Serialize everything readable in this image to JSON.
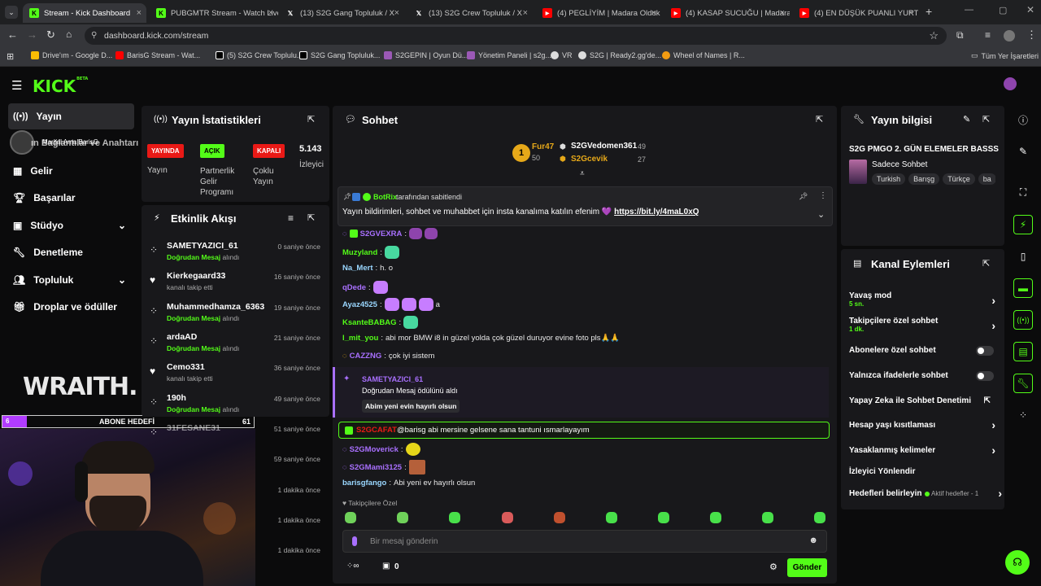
{
  "browser": {
    "tabs": [
      {
        "label": "Stream - Kick Dashboard",
        "icon": "kick-icon",
        "color": "#53fc18"
      },
      {
        "label": "PUBGMTR Stream - Watch Live",
        "icon": "kick-icon",
        "color": "#53fc18"
      },
      {
        "label": "(13) S2G Gang Topluluk / X",
        "icon": "x-icon",
        "color": "#ffffff"
      },
      {
        "label": "(13) S2G Crew Topluluk / X",
        "icon": "x-icon",
        "color": "#ffffff"
      },
      {
        "label": "(4) PEGLİYİM | Madara Olduk #",
        "icon": "youtube-icon",
        "color": "#ff0000"
      },
      {
        "label": "(4) KASAP SUCUĞU | Madara O",
        "icon": "youtube-icon",
        "color": "#ff0000"
      },
      {
        "label": "(4) EN DÜŞÜK PUANLI YURT D",
        "icon": "youtube-icon",
        "color": "#ff0000"
      }
    ],
    "new_tab": "+",
    "url": "dashboard.kick.com/stream",
    "bookmarks": [
      {
        "label": "Drive'ım - Google D...",
        "color": "#fbbc04"
      },
      {
        "label": "BarisG Stream - Wat...",
        "color": "#ff0000"
      },
      {
        "label": "(5) S2G Crew Toplulu...",
        "color": "#ffffff"
      },
      {
        "label": "S2G Gang Topluluk...",
        "color": "#ffffff"
      },
      {
        "label": "S2GEPIN | Oyun Dü...",
        "color": "#9b59b6"
      },
      {
        "label": "Yönetim Paneli | s2g...",
        "color": "#9b59b6"
      },
      {
        "label": "VR",
        "color": "#ffffff"
      },
      {
        "label": "S2G | Ready2.gg'de...",
        "color": "#ffffff"
      },
      {
        "label": "Wheel of Names | R...",
        "color": "#f39c12"
      }
    ],
    "all_bookmarks": "Tüm Yer İşaretleri"
  },
  "kick": {
    "logo": "KICK",
    "logo_beta": "BETA",
    "accent": "#53fc18"
  },
  "sidebar": {
    "items": [
      {
        "label": "Yayın",
        "icon": "broadcast-icon"
      },
      {
        "label": "Gelir",
        "icon": "chart-icon"
      },
      {
        "label": "Başarılar",
        "icon": "trophy-icon"
      },
      {
        "label": "Stüdyo",
        "icon": "studio-icon"
      },
      {
        "label": "Denetleme",
        "icon": "wrench-icon"
      },
      {
        "label": "Topluluk",
        "icon": "people-icon"
      },
      {
        "label": "Droplar ve ödüller",
        "icon": "gift-icon"
      }
    ],
    "overlay_text_1": "Marşal Ama BarisG",
    "overlay_text_2": "ın Bağlantılar ve Anahtarı"
  },
  "overlay": {
    "brand": "WRAITH.",
    "goal_label": "ABONE HEDEFİ",
    "goal_current": "6",
    "goal_target": "61",
    "goal_fraction": 0.098
  },
  "stats": {
    "title": "Yayın İstatistikleri",
    "items": [
      {
        "badge": "YAYINDA",
        "label": "Yayın",
        "color": "#e91916"
      },
      {
        "badge": "AÇIK",
        "label": "Partnerlik Gelir Programı",
        "color": "#53fc18"
      },
      {
        "badge": "KAPALI",
        "label": "Çoklu Yayın",
        "color": "#e91916"
      },
      {
        "badge": "5.143",
        "label": "İzleyici",
        "color": ""
      }
    ]
  },
  "activity": {
    "title": "Etkinlik Akışı",
    "rows": [
      {
        "name": "SAMETYAZICI_61",
        "pre": "",
        "hl": "Doğrudan Mesaj",
        "post": " alındı",
        "time": "0 saniye önce",
        "icon": "gift-icon"
      },
      {
        "name": "Kierkegaard33",
        "pre": "kanalı takip etti",
        "hl": "",
        "post": "",
        "time": "16 saniye önce",
        "icon": "heart-icon"
      },
      {
        "name": "Muhammedhamza_6363",
        "pre": "",
        "hl": "Doğrudan Mesaj",
        "post": " alındı",
        "time": "19 saniye önce",
        "icon": "gift-icon"
      },
      {
        "name": "ardaAD",
        "pre": "",
        "hl": "Doğrudan Mesaj",
        "post": " alındı",
        "time": "21 saniye önce",
        "icon": "gift-icon"
      },
      {
        "name": "Cemo331",
        "pre": "kanalı takip etti",
        "hl": "",
        "post": "",
        "time": "36 saniye önce",
        "icon": "heart-icon"
      },
      {
        "name": "190h",
        "pre": "",
        "hl": "Doğrudan Mesaj",
        "post": " alındı",
        "time": "49 saniye önce",
        "icon": "gift-icon"
      },
      {
        "name": "31FESANE31",
        "pre": "",
        "hl": "",
        "post": "",
        "time": "51 saniye önce",
        "icon": "gift-icon"
      },
      {
        "name": "",
        "pre": "",
        "hl": "",
        "post": "",
        "time": "59 saniye önce",
        "icon": ""
      },
      {
        "name": "",
        "pre": "",
        "hl": "",
        "post": "",
        "time": "1 dakika önce",
        "icon": ""
      },
      {
        "name": "",
        "pre": "",
        "hl": "",
        "post": "",
        "time": "1 dakika önce",
        "icon": ""
      },
      {
        "name": "",
        "pre": "",
        "hl": "",
        "post": "",
        "time": "1 dakika önce",
        "icon": ""
      }
    ]
  },
  "chat": {
    "title": "Sohbet",
    "leaders": {
      "rank": "1",
      "first_name": "Fur47",
      "first_value": "50",
      "second_name": "S2GVedomen361",
      "second_value": "49",
      "third_name": "S2Gcevik",
      "third_value": "27"
    },
    "pinned": {
      "by_user": "BotRix",
      "by_text": "tarafından sabitlendi",
      "text": "Yayın bildirimleri, sohbet ve muhabbet için insta kanalıma katılın efenim 💜",
      "link": "https://bit.ly/4maL0xQ"
    },
    "messages": [
      {
        "user": "S2GVEXRA",
        "text": "",
        "color": "#a970ff"
      },
      {
        "user": "Muzyland",
        "text": "",
        "color": "#53fc18"
      },
      {
        "user": "Na_Mert",
        "text": "h. o",
        "color": "#9ad7ff"
      },
      {
        "user": "qDede",
        "text": "",
        "color": "#a970ff"
      },
      {
        "user": "Ayaz4525",
        "text": "a",
        "color": "#9ad7ff"
      },
      {
        "user": "KsanteBABAG",
        "text": "",
        "color": "#53fc18"
      },
      {
        "user": "l_mit_you",
        "text": "abi mor BMW i8 in güzel yolda çok güzel duruyor evine foto pls🙏🙏",
        "color": "#53fc18"
      },
      {
        "user": "CAZZNG",
        "text": "çok iyi sistem",
        "color": "#a970ff"
      }
    ],
    "reward": {
      "user": "SAMETYAZICI_61",
      "title": "Doğrudan Mesaj ödülünü aldı",
      "message": "Abim yeni evin hayırlı olsun"
    },
    "highlight": {
      "user": "S2GCAFAT",
      "text": "@barisg abi mersine gelsene sana tantuni ısmarlayayım"
    },
    "messages2": [
      {
        "user": "S2GMoverick",
        "text": "",
        "color": "#a970ff"
      },
      {
        "user": "S2GMami3125",
        "text": "",
        "color": "#a970ff"
      },
      {
        "user": "barisgfango",
        "text": "Abi yeni ev hayırlı olsun",
        "color": "#9ad7ff"
      }
    ],
    "followers_only": "Takipçilere Özel",
    "input_placeholder": "Bir mesaj gönderin",
    "bottom_count": "0",
    "send": "Gönder"
  },
  "info": {
    "title": "Yayın bilgisi",
    "stream_title": "S2G PMGO 2. GÜN ELEMELER BASSS",
    "category": "Sadece Sohbet",
    "tags": [
      "Turkish",
      "Barışg",
      "Türkçe",
      "ba"
    ]
  },
  "channel_actions": {
    "title": "Kanal Eylemleri",
    "items": [
      {
        "label": "Yavaş mod",
        "sub": "5 sn.",
        "type": "chevron"
      },
      {
        "label": "Takipçilere özel sohbet",
        "sub": "1 dk.",
        "type": "chevron"
      },
      {
        "label": "Abonelere özel sohbet",
        "sub": "",
        "type": "toggle"
      },
      {
        "label": "Yalnızca ifadelerle sohbet",
        "sub": "",
        "type": "toggle"
      },
      {
        "label": "Yapay Zeka ile Sohbet Denetimi",
        "sub": "",
        "type": "external"
      },
      {
        "label": "Hesap yaşı kısıtlaması",
        "sub": "",
        "type": "chevron"
      },
      {
        "label": "Yasaklanmış kelimeler",
        "sub": "",
        "type": "chevron"
      },
      {
        "label": "İzleyici Yönlendir",
        "sub": "",
        "type": "none"
      },
      {
        "label": "Hedefleri belirleyin",
        "sub": "",
        "type": "goal"
      }
    ],
    "goal_status": "Aktif hedefler - 1"
  }
}
